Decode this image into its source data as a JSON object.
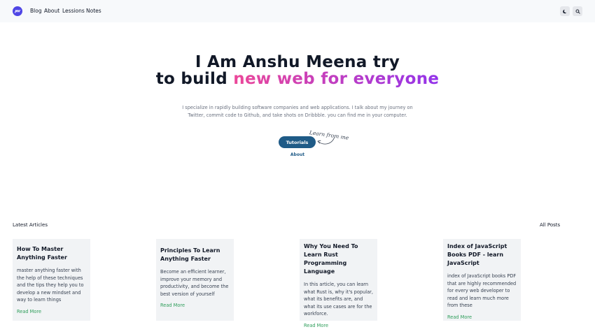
{
  "nav": {
    "links": [
      "Blog",
      "About",
      "Lessions",
      "Notes"
    ],
    "logo_icon": "logo-icon",
    "theme_icon": "moon-icon",
    "search_icon": "search-icon"
  },
  "hero": {
    "title_line1": "I Am Anshu Meena try",
    "title_line2_plain": "to build ",
    "title_line2_accent": "new web for everyone",
    "description": "I specialize in rapidly building software companies and web applications. I talk about my journey on Twitter, commit code to Github, and take shots on Dribbble. you can find me in your computer.",
    "cta_label": "Tutorials",
    "note": "Learn from me",
    "about_label": "About"
  },
  "articles": {
    "heading": "Latest Articles",
    "all_posts": "All Posts",
    "items": [
      {
        "title": "How To Master Anything Faster",
        "desc": "master anything faster with the help of these techniques and the tips they help you to develop a new mindset and way to learn things",
        "more": "Read More"
      },
      {
        "title": "Principles To Learn Anything Faster",
        "desc": "Become an efficient learner, improve your memory and productivity, and become the best version of yourself",
        "more": "Read More"
      },
      {
        "title": "Why You Need To Learn Rust Programming Language",
        "desc": "In this article, you can learn what Rust is, why it's popular, what its benefits are, and what its use cases are for the workforce.",
        "more": "Read More"
      },
      {
        "title": "Index of JavaScript Books PDF - learn JavaScript",
        "desc": "index of JavaScript books PDF that are highly recommended for every web developer to read and learn much more from these",
        "more": "Read More"
      }
    ]
  },
  "colors": {
    "accent_start": "#ec4899",
    "accent_end": "#9333ea",
    "button": "#1f5b87",
    "read_more": "#2f9e5b",
    "card_bg": "#f1f3f5"
  }
}
